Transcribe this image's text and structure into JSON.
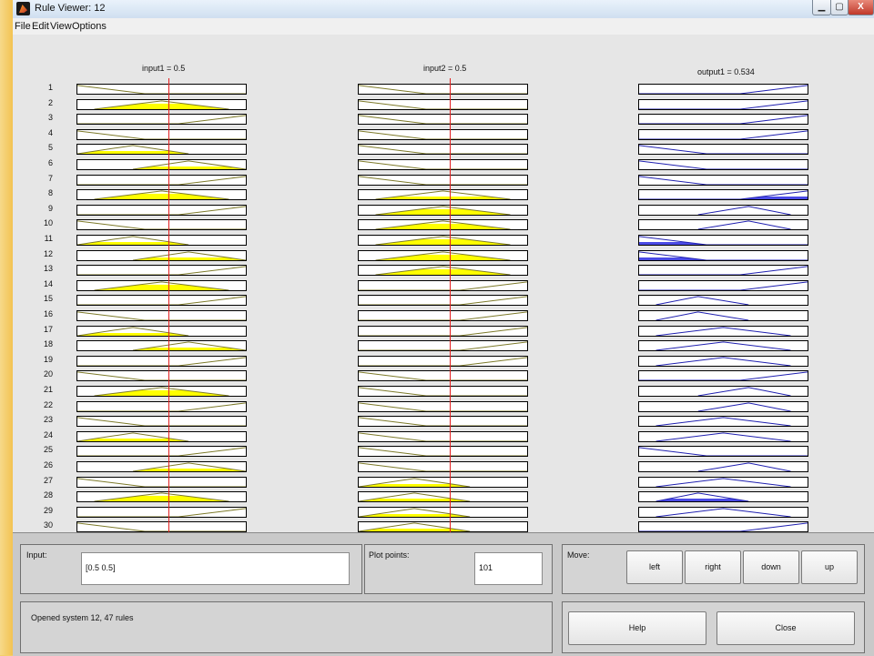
{
  "window": {
    "title": "Rule Viewer: 12",
    "minimize": "▁",
    "maximize": "▢",
    "close": "X"
  },
  "menu": [
    "File",
    "Edit",
    "View",
    "Options"
  ],
  "columns": [
    {
      "title": "input1 = 0.5",
      "value": 0.5,
      "fill_color": "#ffff00",
      "line_color": "#7d7a2a"
    },
    {
      "title": "input2 = 0.5",
      "value": 0.5,
      "fill_color": "#ffff00",
      "line_color": "#7d7a2a"
    },
    {
      "title": "output1 = 0.534",
      "value": 0.534,
      "fill_color": "#4a4ae6",
      "line_color": "#1f1fb0"
    }
  ],
  "rows": [
    {
      "n": "1",
      "mf": [
        [
          "z",
          0.0
        ],
        [
          "z",
          0.0
        ],
        [
          "s",
          0.0
        ]
      ]
    },
    {
      "n": "2",
      "mf": [
        [
          "t",
          0.67
        ],
        [
          "z",
          0.0
        ],
        [
          "s",
          0.0
        ]
      ]
    },
    {
      "n": "3",
      "mf": [
        [
          "s",
          0.0
        ],
        [
          "z",
          0.0
        ],
        [
          "s",
          0.0
        ]
      ]
    },
    {
      "n": "4",
      "mf": [
        [
          "z",
          0.0
        ],
        [
          "z",
          0.0
        ],
        [
          "s",
          0.0
        ]
      ]
    },
    {
      "n": "5",
      "mf": [
        [
          "l",
          0.33
        ],
        [
          "z",
          0.0
        ],
        [
          "z",
          0.0
        ]
      ]
    },
    {
      "n": "6",
      "mf": [
        [
          "r",
          0.33
        ],
        [
          "z",
          0.0
        ],
        [
          "z",
          0.0
        ]
      ]
    },
    {
      "n": "7",
      "mf": [
        [
          "s",
          0.0
        ],
        [
          "z",
          0.0
        ],
        [
          "z",
          0.0
        ]
      ]
    },
    {
      "n": "8",
      "mf": [
        [
          "t",
          0.67
        ],
        [
          "t",
          0.33
        ],
        [
          "s",
          0.33
        ]
      ]
    },
    {
      "n": "9",
      "mf": [
        [
          "s",
          0.0
        ],
        [
          "t",
          0.67
        ],
        [
          "rt",
          0.0
        ]
      ]
    },
    {
      "n": "10",
      "mf": [
        [
          "z",
          0.0
        ],
        [
          "t",
          0.67
        ],
        [
          "rt",
          0.0
        ]
      ]
    },
    {
      "n": "11",
      "mf": [
        [
          "l",
          0.33
        ],
        [
          "t",
          0.67
        ],
        [
          "z",
          0.33
        ]
      ]
    },
    {
      "n": "12",
      "mf": [
        [
          "r",
          0.33
        ],
        [
          "t",
          0.67
        ],
        [
          "z",
          0.33
        ]
      ]
    },
    {
      "n": "13",
      "mf": [
        [
          "s",
          0.0
        ],
        [
          "t",
          0.67
        ],
        [
          "s",
          0.0
        ]
      ]
    },
    {
      "n": "14",
      "mf": [
        [
          "t",
          0.67
        ],
        [
          "s",
          0.0
        ],
        [
          "s",
          0.0
        ]
      ]
    },
    {
      "n": "15",
      "mf": [
        [
          "s",
          0.0
        ],
        [
          "s",
          0.0
        ],
        [
          "lt",
          0.0
        ]
      ]
    },
    {
      "n": "16",
      "mf": [
        [
          "z",
          0.0
        ],
        [
          "s",
          0.0
        ],
        [
          "lt",
          0.0
        ]
      ]
    },
    {
      "n": "17",
      "mf": [
        [
          "l",
          0.33
        ],
        [
          "s",
          0.0
        ],
        [
          "t",
          0.0
        ]
      ]
    },
    {
      "n": "18",
      "mf": [
        [
          "r",
          0.33
        ],
        [
          "s",
          0.0
        ],
        [
          "t",
          0.0
        ]
      ]
    },
    {
      "n": "19",
      "mf": [
        [
          "s",
          0.0
        ],
        [
          "s",
          0.0
        ],
        [
          "t",
          0.0
        ]
      ]
    },
    {
      "n": "20",
      "mf": [
        [
          "z",
          0.0
        ],
        [
          "z",
          0.0
        ],
        [
          "s",
          0.0
        ]
      ]
    },
    {
      "n": "21",
      "mf": [
        [
          "t",
          0.67
        ],
        [
          "z",
          0.0
        ],
        [
          "rt",
          0.0
        ]
      ]
    },
    {
      "n": "22",
      "mf": [
        [
          "s",
          0.0
        ],
        [
          "z",
          0.0
        ],
        [
          "rt",
          0.0
        ]
      ]
    },
    {
      "n": "23",
      "mf": [
        [
          "z",
          0.0
        ],
        [
          "z",
          0.0
        ],
        [
          "t",
          0.0
        ]
      ]
    },
    {
      "n": "24",
      "mf": [
        [
          "l",
          0.33
        ],
        [
          "z",
          0.0
        ],
        [
          "t",
          0.0
        ]
      ]
    },
    {
      "n": "25",
      "mf": [
        [
          "s",
          0.0
        ],
        [
          "z",
          0.0
        ],
        [
          "z",
          0.0
        ]
      ]
    },
    {
      "n": "26",
      "mf": [
        [
          "r",
          0.33
        ],
        [
          "z",
          0.0
        ],
        [
          "rt",
          0.0
        ]
      ]
    },
    {
      "n": "27",
      "mf": [
        [
          "z",
          0.0
        ],
        [
          "l",
          0.33
        ],
        [
          "t",
          0.0
        ]
      ]
    },
    {
      "n": "28",
      "mf": [
        [
          "t",
          0.67
        ],
        [
          "l",
          0.33
        ],
        [
          "lt",
          0.33
        ]
      ]
    },
    {
      "n": "29",
      "mf": [
        [
          "s",
          0.0
        ],
        [
          "l",
          0.33
        ],
        [
          "t",
          0.0
        ]
      ]
    },
    {
      "n": "30",
      "mf": [
        [
          "z",
          0.0
        ],
        [
          "l",
          0.33
        ],
        [
          "s",
          0.0
        ]
      ]
    }
  ],
  "panel": {
    "input_label": "Input:",
    "input_value": "[0.5 0.5]",
    "plot_points_label": "Plot points:",
    "plot_points_value": "101",
    "move_label": "Move:",
    "buttons": {
      "left": "left",
      "right": "right",
      "down": "down",
      "up": "up",
      "help": "Help",
      "close": "Close"
    },
    "status": "Opened system 12, 47 rules"
  }
}
